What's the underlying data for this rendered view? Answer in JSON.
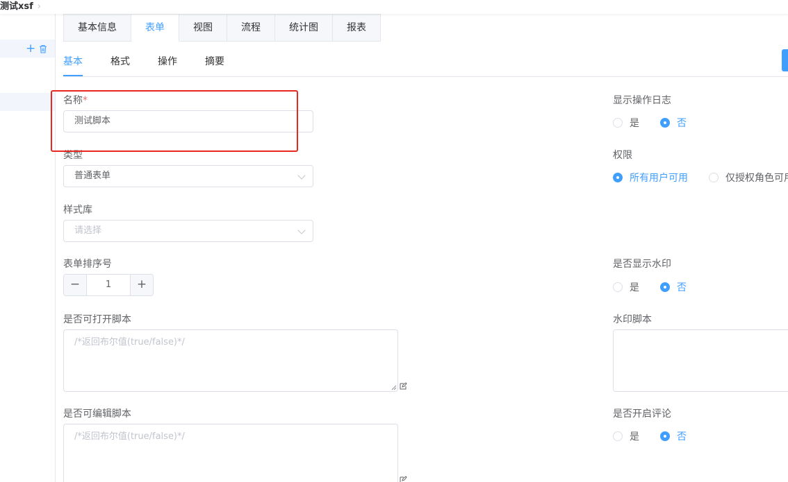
{
  "breadcrumb": {
    "current": "测试xsf",
    "separator": "›"
  },
  "sidebar": {
    "add_label": "+"
  },
  "tabs": [
    {
      "label": "基本信息",
      "active": false
    },
    {
      "label": "表单",
      "active": true
    },
    {
      "label": "视图",
      "active": false
    },
    {
      "label": "流程",
      "active": false
    },
    {
      "label": "统计图",
      "active": false
    },
    {
      "label": "报表",
      "active": false
    }
  ],
  "subtabs": [
    {
      "label": "基本",
      "active": true
    },
    {
      "label": "格式",
      "active": false
    },
    {
      "label": "操作",
      "active": false
    },
    {
      "label": "摘要",
      "active": false
    }
  ],
  "form": {
    "name": {
      "label": "名称",
      "required_mark": "*",
      "value": "测试脚本"
    },
    "type": {
      "label": "类型",
      "value": "普通表单"
    },
    "style_lib": {
      "label": "样式库",
      "placeholder": "请选择"
    },
    "sort_order": {
      "label": "表单排序号",
      "value": "1",
      "minus": "−",
      "plus": "+"
    },
    "open_script": {
      "label": "是否可打开脚本",
      "placeholder": "/*返回布尔值(true/false)*/"
    },
    "edit_script": {
      "label": "是否可编辑脚本",
      "placeholder": "/*返回布尔值(true/false)*/"
    }
  },
  "right": {
    "show_log": {
      "label": "显示操作日志",
      "options": [
        "是",
        "否"
      ],
      "selected": "否"
    },
    "permission": {
      "label": "权限",
      "options": [
        "所有用户可用",
        "仅授权角色可用"
      ],
      "selected": "所有用户可用"
    },
    "watermark": {
      "label": "是否显示水印",
      "options": [
        "是",
        "否"
      ],
      "selected": "否"
    },
    "watermark_script": {
      "label": "水印脚本"
    },
    "comments": {
      "label": "是否开启评论",
      "options": [
        "是",
        "否"
      ],
      "selected": "否"
    }
  },
  "colors": {
    "accent": "#409eff",
    "highlight_box": "#e8281e",
    "border": "#dcdfe6"
  }
}
